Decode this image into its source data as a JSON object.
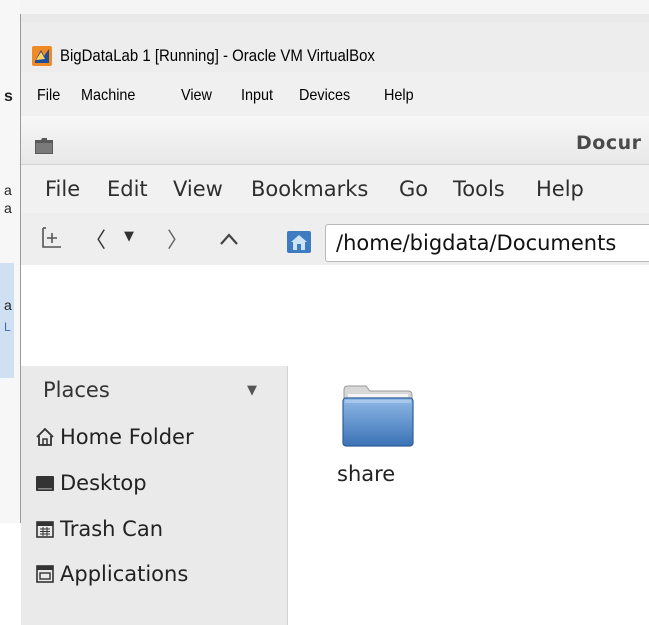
{
  "host": {
    "fragments": [
      "s",
      "a",
      "a",
      "a",
      "L"
    ]
  },
  "vbox": {
    "title": "BigDataLab 1 [Running] - Oracle VM VirtualBox",
    "menu": [
      "File",
      "Machine",
      "View",
      "Input",
      "Devices",
      "Help"
    ]
  },
  "file_manager": {
    "title": "Docur",
    "menu": [
      "File",
      "Edit",
      "View",
      "Bookmarks",
      "Go",
      "Tools",
      "Help"
    ],
    "toolbar": {
      "new_tab_icon": "new-tab-icon",
      "back_icon": "back-arrow-icon",
      "history_icon": "history-dropdown-icon",
      "forward_icon": "forward-arrow-icon",
      "up_icon": "up-arrow-icon",
      "home_icon": "home-icon"
    },
    "address": "/home/bigdata/Documents",
    "sidebar": {
      "header": "Places",
      "items": [
        {
          "label": "Home Folder",
          "icon": "home-icon"
        },
        {
          "label": "Desktop",
          "icon": "desktop-icon"
        },
        {
          "label": "Trash Can",
          "icon": "trash-icon"
        },
        {
          "label": "Applications",
          "icon": "applications-icon"
        }
      ]
    },
    "files": [
      {
        "name": "share",
        "icon": "folder-icon"
      }
    ]
  },
  "colors": {
    "folder_blue": "#4a86c8",
    "vbox_logo_orange": "#f08a24"
  }
}
